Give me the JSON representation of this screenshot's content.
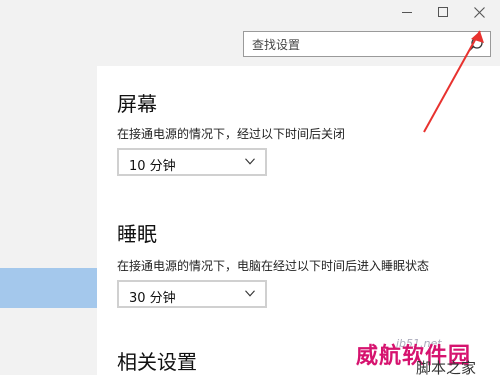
{
  "window": {
    "minimize_icon": "minimize-icon",
    "maximize_icon": "maximize-icon",
    "close_icon": "close-icon"
  },
  "search": {
    "placeholder": "查找设置",
    "icon": "search-icon"
  },
  "screen": {
    "heading": "屏幕",
    "desc": "在接通电源的情况下，经过以下时间后关闭",
    "value": "10 分钟"
  },
  "sleep": {
    "heading": "睡眠",
    "desc": "在接通电源的情况下，电脑在经过以下时间后进入睡眠状态",
    "value": "30 分钟"
  },
  "related": {
    "heading": "相关设置"
  },
  "watermark": {
    "url": "jb51.net",
    "brand": "威航软件园",
    "sub": "脚本之家"
  },
  "colors": {
    "sidebar_selected": "#a4c8ec",
    "annotation_arrow": "#e8322f",
    "watermark_brand": "#d6136f"
  }
}
